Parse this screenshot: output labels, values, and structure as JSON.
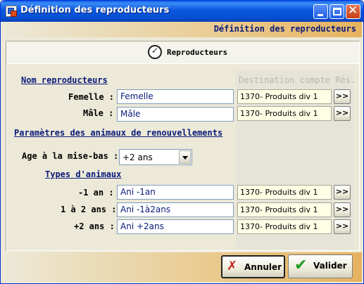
{
  "window": {
    "title": "Définition des reproducteurs",
    "header": "Définition des reproducteurs"
  },
  "tab": {
    "label": "Reproducteurs"
  },
  "sections": {
    "nom": "Nom reproducteurs",
    "destination": "Destination compte Rés.",
    "params": "Paramètres des animaux de renouvellements",
    "types": "Types d'animaux"
  },
  "rows": [
    {
      "label": "Femelle  :",
      "value": "Femelle",
      "dest": "1370- Produits div 1",
      "more": ">>"
    },
    {
      "label": "Mâle  :",
      "value": "Mâle",
      "dest": "1370- Produits div 1",
      "more": ">>"
    },
    {
      "label": "-1 an  :",
      "value": "Ani -1an",
      "dest": "1370- Produits div 1",
      "more": ">>"
    },
    {
      "label": "1 à 2 ans  :",
      "value": "Ani -1à2ans",
      "dest": "1370- Produits div 1",
      "more": ">>"
    },
    {
      "label": "+2 ans  :",
      "value": "Ani +2ans",
      "dest": "1370- Produits div 1",
      "more": ">>"
    }
  ],
  "age": {
    "label": "Age à la mise-bas  :",
    "selected": "+2 ans"
  },
  "buttons": {
    "cancel": "Annuler",
    "ok": "Valider"
  },
  "colors": {
    "accent": "#0a1a7a",
    "titlebar": "#0a57e0",
    "dest_bg": "#ffffe6"
  }
}
